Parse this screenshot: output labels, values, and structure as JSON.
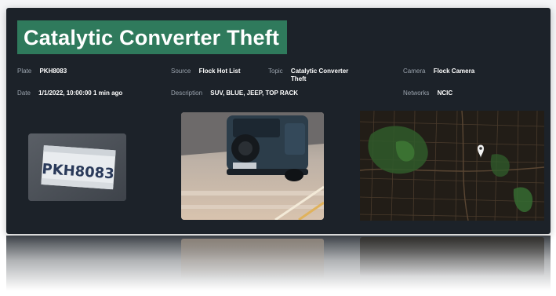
{
  "title": "Catalytic Converter Theft",
  "fields": {
    "plate": {
      "label": "Plate",
      "value": "PKH8083"
    },
    "date": {
      "label": "Date",
      "value": "1/1/2022, 10:00:00 1 min ago"
    },
    "source": {
      "label": "Source",
      "value": "Flock Hot List"
    },
    "description": {
      "label": "Description",
      "value": "SUV, BLUE, JEEP, TOP RACK"
    },
    "topic": {
      "label": "Topic",
      "value": "Catalytic Converter Theft"
    },
    "camera": {
      "label": "Camera",
      "value": "Flock Camera"
    },
    "networks": {
      "label": "Networks",
      "value": "NCIC"
    }
  },
  "plate_image": {
    "text": "PKH8083"
  },
  "colors": {
    "card_bg": "#1c2229",
    "title_bg": "#2f7a5c",
    "label": "#9aa3ad",
    "value": "#ffffff"
  },
  "icons": {
    "map_marker": "map-pin-icon"
  }
}
